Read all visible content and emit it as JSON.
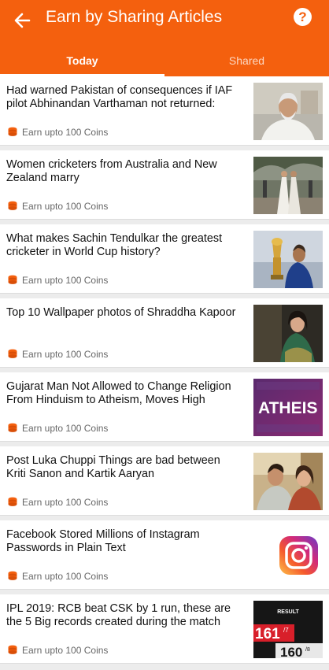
{
  "header": {
    "title": "Earn by Sharing Articles",
    "help_label": "?",
    "tabs": [
      {
        "label": "Today",
        "active": true
      },
      {
        "label": "Shared",
        "active": false
      }
    ]
  },
  "colors": {
    "brand": "#f4600e",
    "coin": "#f4600e"
  },
  "articles": [
    {
      "title": "Had warned Pakistan of consequences if IAF pilot Abhinandan Varthaman not returned:",
      "reward": "Earn upto 100 Coins",
      "thumbnail": "man-in-white-kurta-photo"
    },
    {
      "title": "Women cricketers from Australia and New Zealand marry",
      "reward": "Earn upto 100 Coins",
      "thumbnail": "wedding-photo"
    },
    {
      "title": "What makes Sachin Tendulkar the greatest cricketer in World Cup history?",
      "reward": "Earn upto 100 Coins",
      "thumbnail": "trophy-photo"
    },
    {
      "title": "Top 10 Wallpaper photos of Shraddha Kapoor",
      "reward": "Earn upto 100 Coins",
      "thumbnail": "actress-photo"
    },
    {
      "title": "Gujarat Man Not Allowed to Change Religion From Hinduism to Atheism, Moves High",
      "reward": "Earn upto 100 Coins",
      "thumbnail": "atheism-banner",
      "thumbnail_text": "ATHEIS"
    },
    {
      "title": "Post Luka Chuppi Things are bad between Kriti Sanon and Kartik Aaryan",
      "reward": "Earn upto 100 Coins",
      "thumbnail": "couple-photo"
    },
    {
      "title": "Facebook Stored Millions of Instagram Passwords in Plain Text",
      "reward": "Earn upto 100 Coins",
      "thumbnail": "instagram-logo"
    },
    {
      "title": "IPL 2019: RCB beat CSK by 1 run, these are the 5 Big records created during the match",
      "reward": "Earn upto 100 Coins",
      "thumbnail": "scoreboard",
      "thumbnail_text": {
        "heading": "RESULT",
        "score1": "161",
        "wickets1": "/7",
        "score2": "160",
        "wickets2": "/8"
      }
    }
  ]
}
